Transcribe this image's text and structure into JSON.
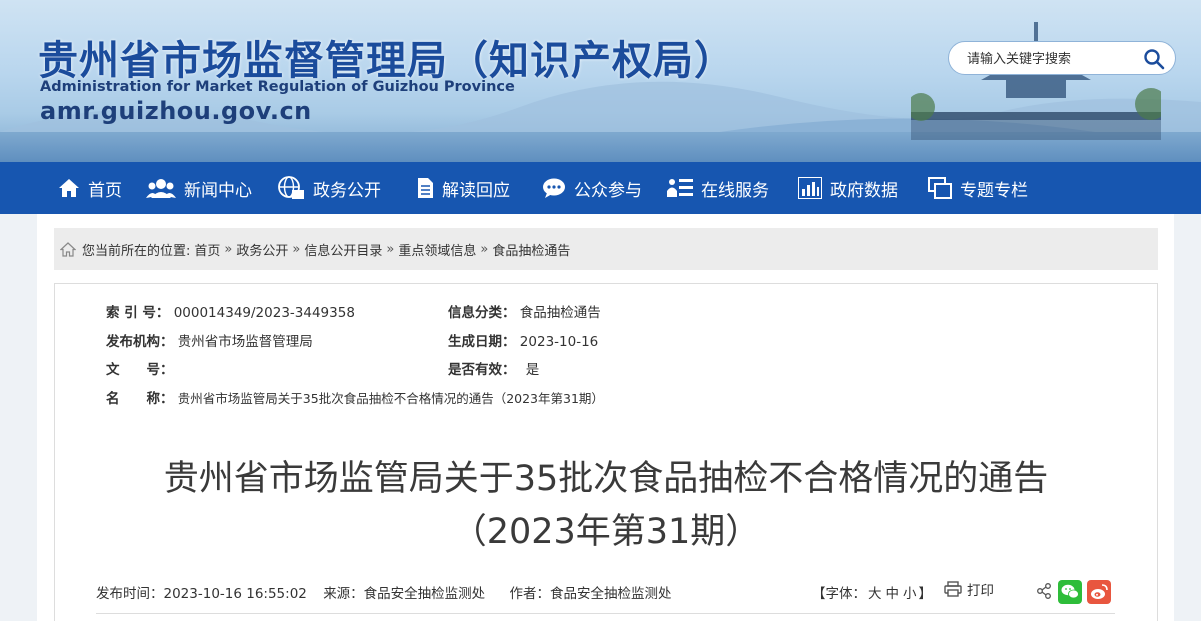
{
  "header": {
    "title_cn": "贵州省市场监督管理局（知识产权局）",
    "title_en": "Administration for Market Regulation of Guizhou Province",
    "url": "amr.guizhou.gov.cn",
    "search_placeholder": "请输入关键字搜索"
  },
  "nav": {
    "items": [
      {
        "label": "首页",
        "icon": "home-icon"
      },
      {
        "label": "新闻中心",
        "icon": "people-icon"
      },
      {
        "label": "政务公开",
        "icon": "globe-icon"
      },
      {
        "label": "解读回应",
        "icon": "document-icon"
      },
      {
        "label": "公众参与",
        "icon": "chat-icon"
      },
      {
        "label": "在线服务",
        "icon": "list-icon"
      },
      {
        "label": "政府数据",
        "icon": "bar-chart-icon"
      },
      {
        "label": "专题专栏",
        "icon": "window-icon"
      }
    ]
  },
  "breadcrumb": {
    "prefix": "您当前所在的位置:",
    "items": [
      "首页",
      "政务公开",
      "信息公开目录",
      "重点领域信息",
      "食品抽检通告"
    ],
    "separator": "»"
  },
  "meta": {
    "index_label": "索 引 号：",
    "index_value": "000014349/2023-3449358",
    "category_label": "信息分类：",
    "category_value": "食品抽检通告",
    "publisher_label": "发布机构：",
    "publisher_value": "贵州省市场监督管理局",
    "date_label": "生成日期：",
    "date_value": "2023-10-16",
    "docno_label": "文　　号：",
    "docno_value": "",
    "valid_label": "是否有效：",
    "valid_value": "是",
    "name_label": "名　　称：",
    "name_value": "贵州省市场监管局关于35批次食品抽检不合格情况的通告（2023年第31期）"
  },
  "article": {
    "title_line1": "贵州省市场监管局关于35批次食品抽检不合格情况的通告",
    "title_line2": "（2023年第31期）",
    "publish_time": "发布时间：2023-10-16 16:55:02",
    "source": "来源：食品安全抽检监测处",
    "author": "作者：食品安全抽检监测处",
    "font_prefix": "【字体：",
    "font_large": "大",
    "font_medium": "中",
    "font_small": "小",
    "font_suffix": "】",
    "print": "打印"
  },
  "colors": {
    "nav_bg": "#1756b0",
    "title_blue": "#1b4c9c",
    "wechat": "#2ebd3a",
    "weibo": "#e8563f"
  }
}
